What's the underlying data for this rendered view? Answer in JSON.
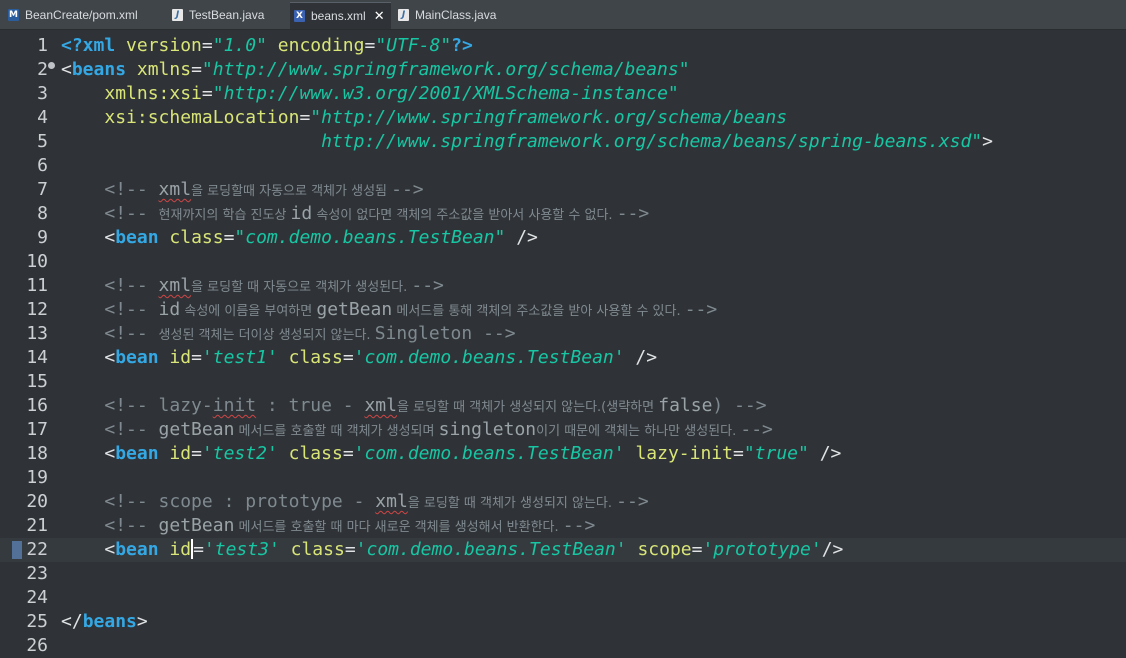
{
  "tabs": [
    {
      "icon": "maven-pom-icon",
      "badge": "M",
      "label": "BeanCreate/pom.xml",
      "active": false
    },
    {
      "icon": "java-file-icon",
      "badge": "J",
      "label": "TestBean.java",
      "active": false
    },
    {
      "icon": "xml-file-icon",
      "badge": "X",
      "label": "beans.xml",
      "active": true
    },
    {
      "icon": "java-file-icon",
      "badge": "J",
      "label": "MainClass.java",
      "active": false
    }
  ],
  "close_glyph": "✕",
  "current_line": 22,
  "lines": [
    {
      "n": "1",
      "tokens": [
        [
          "t-tag",
          "<?xml"
        ],
        [
          "t-punct",
          " "
        ],
        [
          "t-attr",
          "version"
        ],
        [
          "t-punct",
          "="
        ],
        [
          "t-str",
          "\"1.0\""
        ],
        [
          "t-punct",
          " "
        ],
        [
          "t-attr",
          "encoding"
        ],
        [
          "t-punct",
          "="
        ],
        [
          "t-str",
          "\"UTF-8\""
        ],
        [
          "t-tag",
          "?>"
        ]
      ]
    },
    {
      "n": "2",
      "tokens": [
        [
          "t-punct",
          "<"
        ],
        [
          "t-tag",
          "beans"
        ],
        [
          "t-punct",
          " "
        ],
        [
          "t-attr",
          "xmlns"
        ],
        [
          "t-punct",
          "="
        ],
        [
          "t-str",
          "\"http://www.springframework.org/schema/beans\""
        ]
      ]
    },
    {
      "n": "3",
      "tokens": [
        [
          "t-punct",
          "    "
        ],
        [
          "t-attr",
          "xmlns:xsi"
        ],
        [
          "t-punct",
          "="
        ],
        [
          "t-str",
          "\"http://www.w3.org/2001/XMLSchema-instance\""
        ]
      ]
    },
    {
      "n": "4",
      "tokens": [
        [
          "t-punct",
          "    "
        ],
        [
          "t-attr",
          "xsi:schemaLocation"
        ],
        [
          "t-punct",
          "="
        ],
        [
          "t-str",
          "\"http://www.springframework.org/schema/beans"
        ]
      ]
    },
    {
      "n": "5",
      "tokens": [
        [
          "t-punct",
          "                        "
        ],
        [
          "t-str",
          "http://www.springframework.org/schema/beans/spring-beans.xsd\""
        ],
        [
          "t-punct",
          ">"
        ]
      ]
    },
    {
      "n": "6",
      "tokens": []
    },
    {
      "n": "7",
      "tokens": [
        [
          "t-punct",
          "    "
        ],
        [
          "t-cmt",
          "<!-- "
        ],
        [
          "t-cmtb squig",
          "xml"
        ],
        [
          "t-cmt k",
          "을 로딩할때 자동으로 객체가 생성됨 "
        ],
        [
          "t-cmt",
          "-->"
        ]
      ]
    },
    {
      "n": "8",
      "tokens": [
        [
          "t-punct",
          "    "
        ],
        [
          "t-cmt",
          "<!-- "
        ],
        [
          "t-cmt k",
          "현재까지의 학습 진도상 "
        ],
        [
          "t-cmtb",
          "id"
        ],
        [
          "t-cmt k",
          " 속성이 없다면 객체의 주소값을 받아서 사용할 수 없다. "
        ],
        [
          "t-cmt",
          "-->"
        ]
      ]
    },
    {
      "n": "9",
      "tokens": [
        [
          "t-punct",
          "    <"
        ],
        [
          "t-tag",
          "bean"
        ],
        [
          "t-punct",
          " "
        ],
        [
          "t-attr",
          "class"
        ],
        [
          "t-punct",
          "="
        ],
        [
          "t-str",
          "\"com.demo.beans.TestBean\""
        ],
        [
          "t-punct",
          " />"
        ]
      ]
    },
    {
      "n": "10",
      "tokens": []
    },
    {
      "n": "11",
      "tokens": [
        [
          "t-punct",
          "    "
        ],
        [
          "t-cmt",
          "<!-- "
        ],
        [
          "t-cmtb squig",
          "xml"
        ],
        [
          "t-cmt k",
          "을 로딩할 때 자동으로 객체가 생성된다. "
        ],
        [
          "t-cmt",
          "-->"
        ]
      ]
    },
    {
      "n": "12",
      "tokens": [
        [
          "t-punct",
          "    "
        ],
        [
          "t-cmt",
          "<!-- "
        ],
        [
          "t-cmtb",
          "id"
        ],
        [
          "t-cmt k",
          " 속성에 이름을 부여하면 "
        ],
        [
          "t-cmtb",
          "getBean"
        ],
        [
          "t-cmt k",
          " 메서드를 통해 객체의 주소값을 받아 사용할 수 있다. "
        ],
        [
          "t-cmt",
          "-->"
        ]
      ]
    },
    {
      "n": "13",
      "tokens": [
        [
          "t-punct",
          "    "
        ],
        [
          "t-cmt",
          "<!-- "
        ],
        [
          "t-cmt k",
          "생성된 객체는 더이상 생성되지 않는다. "
        ],
        [
          "t-cmt",
          "Singleton -->"
        ]
      ]
    },
    {
      "n": "14",
      "tokens": [
        [
          "t-punct",
          "    <"
        ],
        [
          "t-tag",
          "bean"
        ],
        [
          "t-punct",
          " "
        ],
        [
          "t-attr",
          "id"
        ],
        [
          "t-punct",
          "="
        ],
        [
          "t-str",
          "'test1'"
        ],
        [
          "t-punct",
          " "
        ],
        [
          "t-attr",
          "class"
        ],
        [
          "t-punct",
          "="
        ],
        [
          "t-str",
          "'com.demo.beans.TestBean'"
        ],
        [
          "t-punct",
          " />"
        ]
      ]
    },
    {
      "n": "15",
      "tokens": []
    },
    {
      "n": "16",
      "tokens": [
        [
          "t-punct",
          "    "
        ],
        [
          "t-cmt",
          "<!-- lazy-"
        ],
        [
          "t-cmt squig",
          "init"
        ],
        [
          "t-cmt",
          " : true - "
        ],
        [
          "t-cmtb squig",
          "xml"
        ],
        [
          "t-cmt k",
          "을 로딩할 때 객체가 생성되지 않는다.(생략하면 "
        ],
        [
          "t-cmtb",
          "false"
        ],
        [
          "t-cmt",
          ") -->"
        ]
      ]
    },
    {
      "n": "17",
      "tokens": [
        [
          "t-punct",
          "    "
        ],
        [
          "t-cmt",
          "<!-- "
        ],
        [
          "t-cmtb",
          "getBean"
        ],
        [
          "t-cmt k",
          " 메서드를 호출할 때 객체가 생성되며 "
        ],
        [
          "t-cmtb",
          "singleton"
        ],
        [
          "t-cmt k",
          "이기 때문에 객체는 하나만 생성된다. "
        ],
        [
          "t-cmt",
          "-->"
        ]
      ]
    },
    {
      "n": "18",
      "tokens": [
        [
          "t-punct",
          "    <"
        ],
        [
          "t-tag",
          "bean"
        ],
        [
          "t-punct",
          " "
        ],
        [
          "t-attr",
          "id"
        ],
        [
          "t-punct",
          "="
        ],
        [
          "t-str",
          "'test2'"
        ],
        [
          "t-punct",
          " "
        ],
        [
          "t-attr",
          "class"
        ],
        [
          "t-punct",
          "="
        ],
        [
          "t-str",
          "'com.demo.beans.TestBean'"
        ],
        [
          "t-punct",
          " "
        ],
        [
          "t-attr",
          "lazy-init"
        ],
        [
          "t-punct",
          "="
        ],
        [
          "t-str",
          "\"true\""
        ],
        [
          "t-punct",
          " />"
        ]
      ]
    },
    {
      "n": "19",
      "tokens": []
    },
    {
      "n": "20",
      "tokens": [
        [
          "t-punct",
          "    "
        ],
        [
          "t-cmt",
          "<!-- scope : prototype - "
        ],
        [
          "t-cmtb squig",
          "xml"
        ],
        [
          "t-cmt k",
          "을 로딩할 때 객체가 생성되지 않는다. "
        ],
        [
          "t-cmt",
          "-->"
        ]
      ]
    },
    {
      "n": "21",
      "tokens": [
        [
          "t-punct",
          "    "
        ],
        [
          "t-cmt",
          "<!-- "
        ],
        [
          "t-cmtb",
          "getBean"
        ],
        [
          "t-cmt k",
          " 메서드를 호출할 때 마다 새로운 객체를 생성해서 반환한다. "
        ],
        [
          "t-cmt",
          "-->"
        ]
      ]
    },
    {
      "n": "22",
      "tokens": [
        [
          "t-punct",
          "    <"
        ],
        [
          "t-tag",
          "bean"
        ],
        [
          "t-punct",
          " "
        ],
        [
          "t-attr",
          "id"
        ],
        [
          "caret",
          ""
        ],
        [
          "t-punct",
          "="
        ],
        [
          "t-str",
          "'test3'"
        ],
        [
          "t-punct",
          " "
        ],
        [
          "t-attr",
          "class"
        ],
        [
          "t-punct",
          "="
        ],
        [
          "t-str",
          "'com.demo.beans.TestBean'"
        ],
        [
          "t-punct",
          " "
        ],
        [
          "t-attr",
          "scope"
        ],
        [
          "t-punct",
          "="
        ],
        [
          "t-str",
          "'prototype'"
        ],
        [
          "t-punct",
          "/>"
        ]
      ]
    },
    {
      "n": "23",
      "tokens": []
    },
    {
      "n": "24",
      "tokens": []
    },
    {
      "n": "25",
      "tokens": [
        [
          "t-punct",
          "</"
        ],
        [
          "t-tag",
          "beans"
        ],
        [
          "t-punct",
          ">"
        ]
      ]
    },
    {
      "n": "26",
      "tokens": []
    }
  ]
}
